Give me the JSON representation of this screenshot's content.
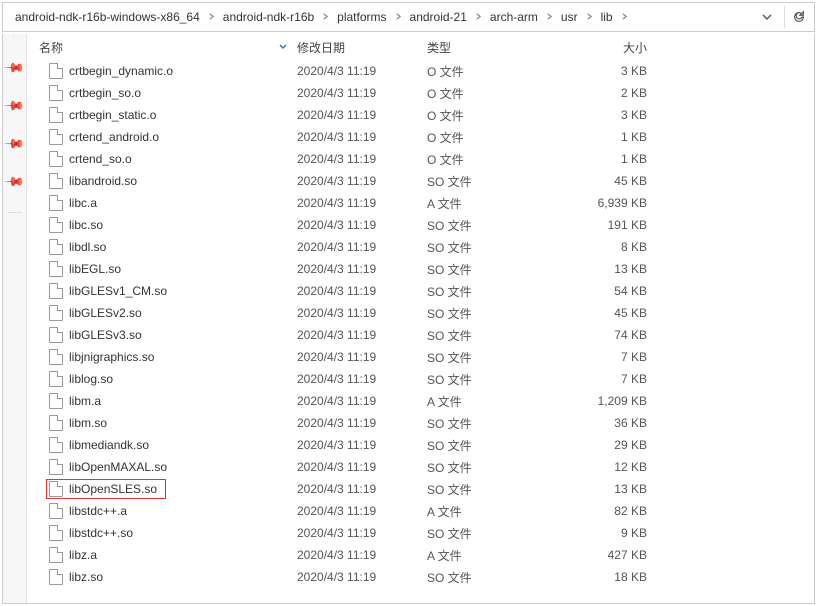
{
  "breadcrumb": {
    "items": [
      "android-ndk-r16b-windows-x86_64",
      "android-ndk-r16b",
      "platforms",
      "android-21",
      "arch-arm",
      "usr",
      "lib"
    ]
  },
  "columns": {
    "name": "名称",
    "date": "修改日期",
    "type": "类型",
    "size": "大小"
  },
  "files": [
    {
      "name": "crtbegin_dynamic.o",
      "date": "2020/4/3 11:19",
      "type": "O 文件",
      "size": "3 KB",
      "highlight": false
    },
    {
      "name": "crtbegin_so.o",
      "date": "2020/4/3 11:19",
      "type": "O 文件",
      "size": "2 KB",
      "highlight": false
    },
    {
      "name": "crtbegin_static.o",
      "date": "2020/4/3 11:19",
      "type": "O 文件",
      "size": "3 KB",
      "highlight": false
    },
    {
      "name": "crtend_android.o",
      "date": "2020/4/3 11:19",
      "type": "O 文件",
      "size": "1 KB",
      "highlight": false
    },
    {
      "name": "crtend_so.o",
      "date": "2020/4/3 11:19",
      "type": "O 文件",
      "size": "1 KB",
      "highlight": false
    },
    {
      "name": "libandroid.so",
      "date": "2020/4/3 11:19",
      "type": "SO 文件",
      "size": "45 KB",
      "highlight": false
    },
    {
      "name": "libc.a",
      "date": "2020/4/3 11:19",
      "type": "A 文件",
      "size": "6,939 KB",
      "highlight": false
    },
    {
      "name": "libc.so",
      "date": "2020/4/3 11:19",
      "type": "SO 文件",
      "size": "191 KB",
      "highlight": false
    },
    {
      "name": "libdl.so",
      "date": "2020/4/3 11:19",
      "type": "SO 文件",
      "size": "8 KB",
      "highlight": false
    },
    {
      "name": "libEGL.so",
      "date": "2020/4/3 11:19",
      "type": "SO 文件",
      "size": "13 KB",
      "highlight": false
    },
    {
      "name": "libGLESv1_CM.so",
      "date": "2020/4/3 11:19",
      "type": "SO 文件",
      "size": "54 KB",
      "highlight": false
    },
    {
      "name": "libGLESv2.so",
      "date": "2020/4/3 11:19",
      "type": "SO 文件",
      "size": "45 KB",
      "highlight": false
    },
    {
      "name": "libGLESv3.so",
      "date": "2020/4/3 11:19",
      "type": "SO 文件",
      "size": "74 KB",
      "highlight": false
    },
    {
      "name": "libjnigraphics.so",
      "date": "2020/4/3 11:19",
      "type": "SO 文件",
      "size": "7 KB",
      "highlight": false
    },
    {
      "name": "liblog.so",
      "date": "2020/4/3 11:19",
      "type": "SO 文件",
      "size": "7 KB",
      "highlight": false
    },
    {
      "name": "libm.a",
      "date": "2020/4/3 11:19",
      "type": "A 文件",
      "size": "1,209 KB",
      "highlight": false
    },
    {
      "name": "libm.so",
      "date": "2020/4/3 11:19",
      "type": "SO 文件",
      "size": "36 KB",
      "highlight": false
    },
    {
      "name": "libmediandk.so",
      "date": "2020/4/3 11:19",
      "type": "SO 文件",
      "size": "29 KB",
      "highlight": false
    },
    {
      "name": "libOpenMAXAL.so",
      "date": "2020/4/3 11:19",
      "type": "SO 文件",
      "size": "12 KB",
      "highlight": false
    },
    {
      "name": "libOpenSLES.so",
      "date": "2020/4/3 11:19",
      "type": "SO 文件",
      "size": "13 KB",
      "highlight": true
    },
    {
      "name": "libstdc++.a",
      "date": "2020/4/3 11:19",
      "type": "A 文件",
      "size": "82 KB",
      "highlight": false
    },
    {
      "name": "libstdc++.so",
      "date": "2020/4/3 11:19",
      "type": "SO 文件",
      "size": "9 KB",
      "highlight": false
    },
    {
      "name": "libz.a",
      "date": "2020/4/3 11:19",
      "type": "A 文件",
      "size": "427 KB",
      "highlight": false
    },
    {
      "name": "libz.so",
      "date": "2020/4/3 11:19",
      "type": "SO 文件",
      "size": "18 KB",
      "highlight": false
    }
  ]
}
